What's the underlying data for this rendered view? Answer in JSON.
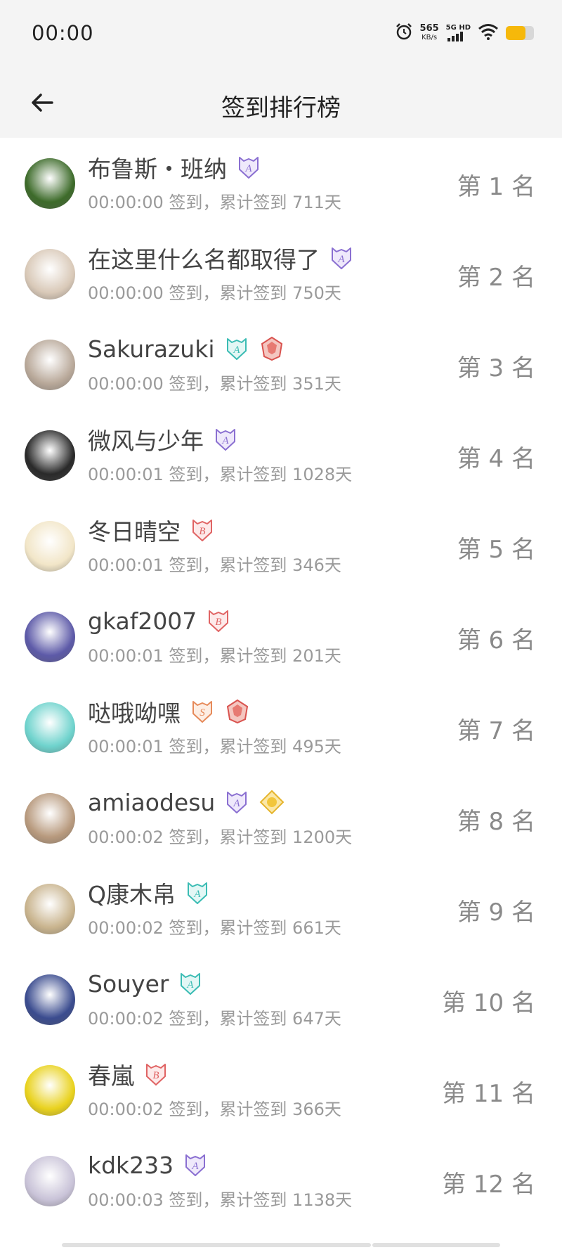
{
  "status_bar": {
    "time": "00:00",
    "speed_value": "565",
    "speed_unit": "KB/s",
    "network": "5G HD",
    "battery_level": 0.7,
    "battery_color": "#f6b80a"
  },
  "header": {
    "title": "签到排行榜",
    "back_icon": "arrow-left-icon"
  },
  "rows": [
    {
      "name": "布鲁斯・班纳",
      "sub": "00:00:00 签到，累计签到 711天",
      "rank": "第 1 名",
      "badges": [
        "A-purple"
      ],
      "avatar": "#3d6b2a"
    },
    {
      "name": "在这里什么名都取得了",
      "sub": "00:00:00 签到，累计签到 750天",
      "rank": "第 2 名",
      "badges": [
        "A-purple"
      ],
      "avatar": "#d9c9b8"
    },
    {
      "name": "Sakurazuki",
      "sub": "00:00:00 签到，累计签到 351天",
      "rank": "第 3 名",
      "badges": [
        "A-teal",
        "crest-red"
      ],
      "avatar": "#b9a99a"
    },
    {
      "name": "微风与少年",
      "sub": "00:00:01 签到，累计签到 1028天",
      "rank": "第 4 名",
      "badges": [
        "A-purple"
      ],
      "avatar": "#2a2a2a"
    },
    {
      "name": "冬日晴空",
      "sub": "00:00:01 签到，累计签到 346天",
      "rank": "第 5 名",
      "badges": [
        "B-red"
      ],
      "avatar": "#f2e6c8"
    },
    {
      "name": "gkaf2007",
      "sub": "00:00:01 签到，累计签到 201天",
      "rank": "第 6 名",
      "badges": [
        "B-red"
      ],
      "avatar": "#5d5aa8"
    },
    {
      "name": "哒哦呦嘿",
      "sub": "00:00:01 签到，累计签到 495天",
      "rank": "第 7 名",
      "badges": [
        "S-orange",
        "crest-red"
      ],
      "avatar": "#6fd3cd"
    },
    {
      "name": "amiaodesu",
      "sub": "00:00:02 签到，累计签到 1200天",
      "rank": "第 8 名",
      "badges": [
        "A-purple",
        "gem-gold"
      ],
      "avatar": "#b89a7e"
    },
    {
      "name": "Q康木帛",
      "sub": "00:00:02 签到，累计签到 661天",
      "rank": "第 9 名",
      "badges": [
        "A-teal"
      ],
      "avatar": "#c9b48e"
    },
    {
      "name": "Souyer",
      "sub": "00:00:02 签到，累计签到 647天",
      "rank": "第 10 名",
      "badges": [
        "A-teal"
      ],
      "avatar": "#3b4c8f"
    },
    {
      "name": "春嵐",
      "sub": "00:00:02 签到，累计签到 366天",
      "rank": "第 11 名",
      "badges": [
        "B-red"
      ],
      "avatar": "#e9d21e"
    },
    {
      "name": "kdk233",
      "sub": "00:00:03 签到，累计签到 1138天",
      "rank": "第 12 名",
      "badges": [
        "A-purple"
      ],
      "avatar": "#c9c3d8"
    }
  ]
}
